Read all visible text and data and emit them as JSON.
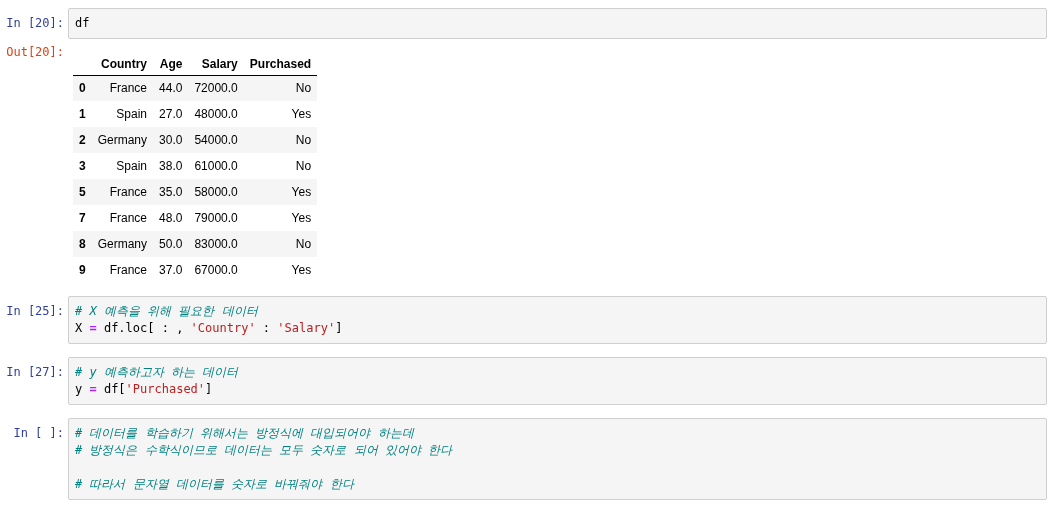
{
  "cells": [
    {
      "prompt": "In [20]:",
      "lines": [
        {
          "tokens": [
            {
              "kind": "plain",
              "text": "df"
            }
          ]
        }
      ],
      "output": {
        "prompt": "Out[20]:",
        "table": {
          "columns": [
            "",
            "Country",
            "Age",
            "Salary",
            "Purchased"
          ],
          "rows": [
            {
              "cells": [
                "0",
                "France",
                "44.0",
                "72000.0",
                "No"
              ]
            },
            {
              "cells": [
                "1",
                "Spain",
                "27.0",
                "48000.0",
                "Yes"
              ]
            },
            {
              "cells": [
                "2",
                "Germany",
                "30.0",
                "54000.0",
                "No"
              ]
            },
            {
              "cells": [
                "3",
                "Spain",
                "38.0",
                "61000.0",
                "No"
              ]
            },
            {
              "cells": [
                "5",
                "France",
                "35.0",
                "58000.0",
                "Yes"
              ]
            },
            {
              "cells": [
                "7",
                "France",
                "48.0",
                "79000.0",
                "Yes"
              ]
            },
            {
              "cells": [
                "8",
                "Germany",
                "50.0",
                "83000.0",
                "No"
              ]
            },
            {
              "cells": [
                "9",
                "France",
                "37.0",
                "67000.0",
                "Yes"
              ]
            }
          ]
        }
      }
    },
    {
      "prompt": "In [25]:",
      "lines": [
        {
          "tokens": [
            {
              "kind": "comment",
              "text": "# X 예측을 위해 필요한 데이터"
            }
          ]
        },
        {
          "tokens": [
            {
              "kind": "plain",
              "text": "X "
            },
            {
              "kind": "operator",
              "text": "="
            },
            {
              "kind": "plain",
              "text": " df.loc[ : , "
            },
            {
              "kind": "string",
              "text": "'Country'"
            },
            {
              "kind": "plain",
              "text": " : "
            },
            {
              "kind": "string",
              "text": "'Salary'"
            },
            {
              "kind": "plain",
              "text": "]"
            }
          ]
        }
      ]
    },
    {
      "prompt": "In [27]:",
      "lines": [
        {
          "tokens": [
            {
              "kind": "comment",
              "text": "# y 예측하고자 하는 데이터"
            }
          ]
        },
        {
          "tokens": [
            {
              "kind": "plain",
              "text": "y "
            },
            {
              "kind": "operator",
              "text": "="
            },
            {
              "kind": "plain",
              "text": " df["
            },
            {
              "kind": "string",
              "text": "'Purchased'"
            },
            {
              "kind": "plain",
              "text": "]"
            }
          ]
        }
      ]
    },
    {
      "prompt": "In [ ]:",
      "lines": [
        {
          "tokens": [
            {
              "kind": "comment",
              "text": "# 데이터를 학습하기 위해서는 방정식에 대입되어야 하는데"
            }
          ]
        },
        {
          "tokens": [
            {
              "kind": "comment",
              "text": "# 방정식은 수학식이므로 데이터는 모두 숫자로 되어 있어야 한다"
            }
          ]
        },
        {
          "blank_before": true,
          "tokens": [
            {
              "kind": "comment",
              "text": "# 따라서 문자열 데이터를 숫자로 바꿔줘야 한다"
            }
          ]
        }
      ]
    }
  ]
}
